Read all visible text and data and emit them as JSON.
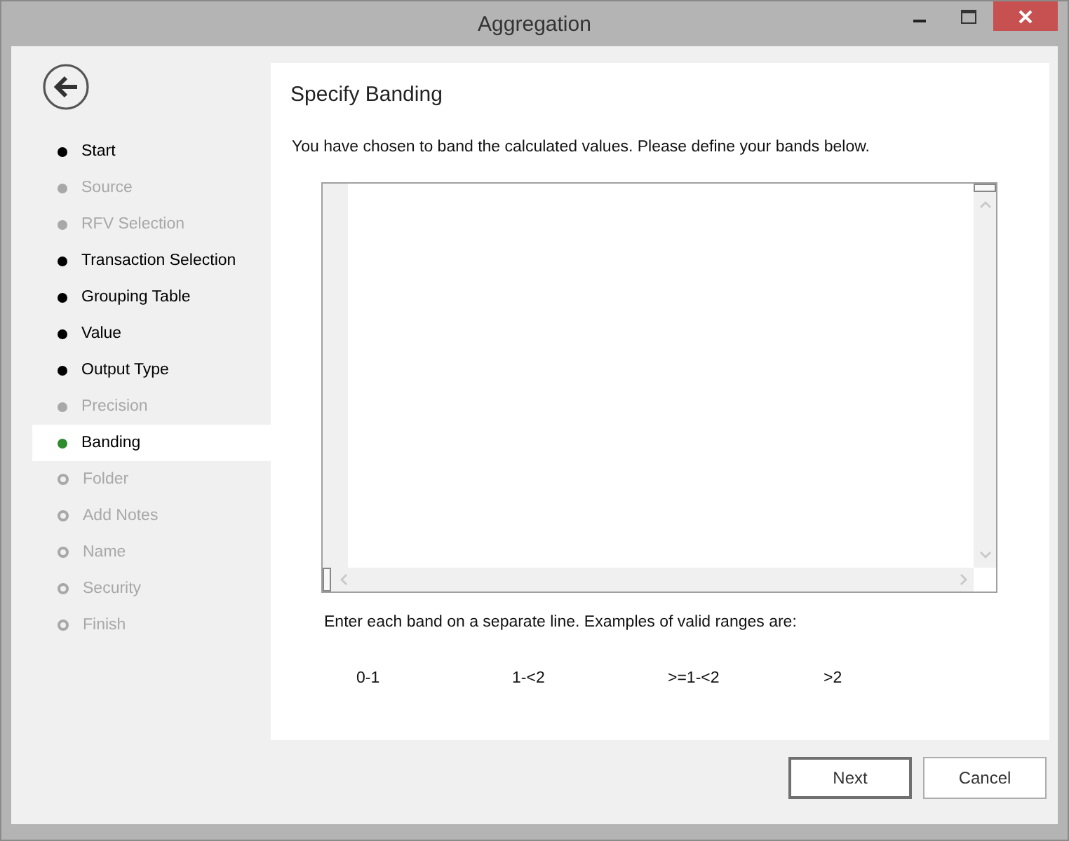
{
  "window": {
    "title": "Aggregation"
  },
  "steps": [
    {
      "label": "Start",
      "kind": "done",
      "selected": false
    },
    {
      "label": "Source",
      "kind": "skipped",
      "selected": false
    },
    {
      "label": "RFV Selection",
      "kind": "skipped",
      "selected": false
    },
    {
      "label": "Transaction Selection",
      "kind": "done",
      "selected": false
    },
    {
      "label": "Grouping Table",
      "kind": "done",
      "selected": false
    },
    {
      "label": "Value",
      "kind": "done",
      "selected": false
    },
    {
      "label": "Output Type",
      "kind": "done",
      "selected": false
    },
    {
      "label": "Precision",
      "kind": "skipped",
      "selected": false
    },
    {
      "label": "Banding",
      "kind": "current",
      "selected": true
    },
    {
      "label": "Folder",
      "kind": "pending",
      "selected": false
    },
    {
      "label": "Add Notes",
      "kind": "pending",
      "selected": false
    },
    {
      "label": "Name",
      "kind": "pending",
      "selected": false
    },
    {
      "label": "Security",
      "kind": "pending",
      "selected": false
    },
    {
      "label": "Finish",
      "kind": "pending",
      "selected": false
    }
  ],
  "page": {
    "heading": "Specify Banding",
    "intro": "You have chosen to band the calculated values. Please define your bands below.",
    "hint": "Enter each band on a separate line. Examples of valid ranges are:",
    "examples": [
      "0-1",
      "1-<2",
      ">=1-<2",
      ">2"
    ]
  },
  "buttons": [
    "Next",
    "Cancel"
  ]
}
